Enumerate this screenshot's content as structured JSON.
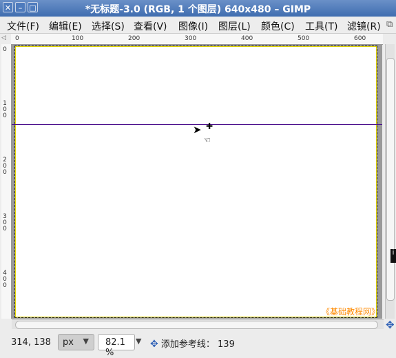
{
  "window": {
    "title": "*无标题-3.0 (RGB, 1 个图层) 640x480 – GIMP",
    "buttons": [
      "close",
      "minimize",
      "maximize"
    ]
  },
  "menu": {
    "items": [
      "文件(F)",
      "编辑(E)",
      "选择(S)",
      "查看(V)",
      "图像(I)",
      "图层(L)",
      "颜色(C)",
      "工具(T)",
      "滤镜(R)"
    ]
  },
  "hruler": {
    "labels": [
      "0",
      "100",
      "200",
      "300",
      "400",
      "500",
      "600"
    ]
  },
  "vruler": {
    "labels": [
      "0",
      "1\n0\n0",
      "2\n0\n0",
      "3\n0\n0",
      "4\n0\n0"
    ]
  },
  "status": {
    "coords": "314, 138",
    "unit": "px",
    "zoom": "82.1 %",
    "message": "添加参考线：",
    "message_value": "139"
  },
  "watermark": "《基础教程网》",
  "colors": {
    "titlebar": "#4f7cbf",
    "guide": "#4b0f8c",
    "watermark": "#ff8a00"
  }
}
